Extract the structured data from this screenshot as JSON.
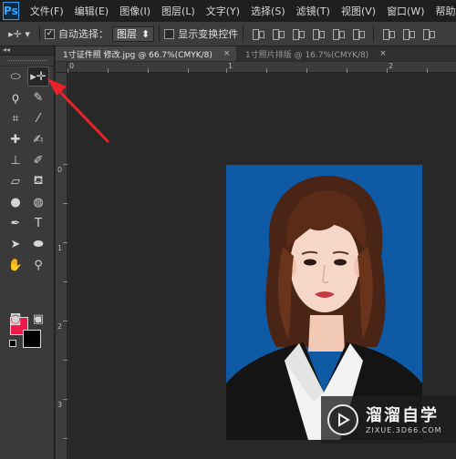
{
  "app": {
    "logo": "Ps",
    "menu": [
      "文件(F)",
      "编辑(E)",
      "图像(I)",
      "图层(L)",
      "文字(Y)",
      "选择(S)",
      "滤镜(T)",
      "视图(V)",
      "窗口(W)",
      "帮助(H)"
    ]
  },
  "options": {
    "tool_glyph": "▸✛ ▾",
    "auto_select_label": "自动选择：",
    "auto_select_checked": true,
    "auto_select_target": "图层",
    "show_transform_label": "显示变换控件",
    "show_transform_checked": false
  },
  "toolpanel": {
    "collapse_glyph": "◂◂",
    "tools": [
      {
        "name": "rect-marquee-tool-icon",
        "glyph": "⬭"
      },
      {
        "name": "move-tool-icon",
        "glyph": "▸✛"
      },
      {
        "name": "lasso-tool-icon",
        "glyph": "ϙ"
      },
      {
        "name": "quick-selection-tool-icon",
        "glyph": "✎"
      },
      {
        "name": "crop-tool-icon",
        "glyph": "⌗"
      },
      {
        "name": "eyedropper-tool-icon",
        "glyph": "⁄"
      },
      {
        "name": "healing-brush-tool-icon",
        "glyph": "✚"
      },
      {
        "name": "brush-tool-icon",
        "glyph": "✍"
      },
      {
        "name": "clone-stamp-tool-icon",
        "glyph": "⊥"
      },
      {
        "name": "history-brush-tool-icon",
        "glyph": "✐"
      },
      {
        "name": "eraser-tool-icon",
        "glyph": "▱"
      },
      {
        "name": "paint-bucket-tool-icon",
        "glyph": "⛾"
      },
      {
        "name": "blur-tool-icon",
        "glyph": "●"
      },
      {
        "name": "dodge-tool-icon",
        "glyph": "◍"
      },
      {
        "name": "pen-tool-icon",
        "glyph": "✒"
      },
      {
        "name": "type-tool-icon",
        "glyph": "T"
      },
      {
        "name": "path-selection-tool-icon",
        "glyph": "➤"
      },
      {
        "name": "ellipse-tool-icon",
        "glyph": "⬬"
      },
      {
        "name": "hand-tool-icon",
        "glyph": "✋"
      },
      {
        "name": "zoom-tool-icon",
        "glyph": "⚲"
      },
      {
        "name": "quick-mask-icon",
        "glyph": "◙"
      },
      {
        "name": "screen-mode-icon",
        "glyph": "▣"
      }
    ],
    "foreground_color": "#ee1a4a",
    "background_color": "#000000",
    "swap_glyph": "↰"
  },
  "tabs": [
    {
      "label": "1寸证件照 修改.jpg @ 66.7%(CMYK/8)",
      "close": "×",
      "active": true
    },
    {
      "label": "1寸照片排版 @ 16.7%(CMYK/8)",
      "close": "×",
      "active": false
    }
  ],
  "rulers": {
    "h_labels": [
      "0",
      "1",
      "2"
    ],
    "v_labels": [
      "0",
      "1",
      "2",
      "3"
    ]
  },
  "watermark": {
    "title": "溜溜自学",
    "url": "ZIXUE.3D66.COM"
  },
  "colors": {
    "photo_background": "#0e5aa5",
    "annotation_arrow": "#e8232a"
  }
}
